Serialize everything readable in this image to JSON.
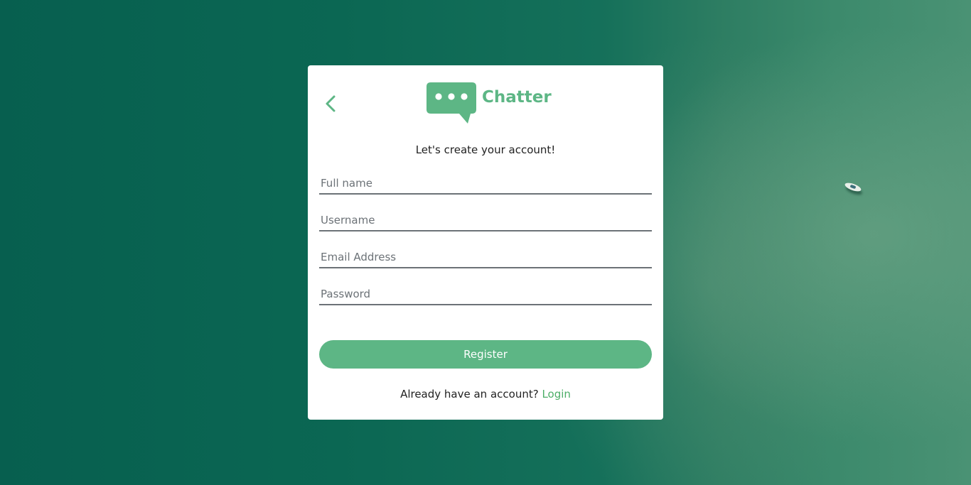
{
  "app": {
    "brand": "Chatter",
    "subtitle": "Let's create your account!"
  },
  "form": {
    "full_name": {
      "placeholder": "Full name",
      "value": ""
    },
    "username": {
      "placeholder": "Username",
      "value": ""
    },
    "email": {
      "placeholder": "Email Address",
      "value": ""
    },
    "password": {
      "placeholder": "Password",
      "value": ""
    },
    "register_label": "Register"
  },
  "footer": {
    "prompt": "Already have an account?",
    "login_label": "Login"
  },
  "colors": {
    "accent": "#5db685",
    "link": "#4cae67",
    "text": "#222222",
    "field_border": "#6c7277"
  },
  "icons": {
    "back": "chevron-left-icon",
    "logo": "chat-bubble-icon"
  }
}
